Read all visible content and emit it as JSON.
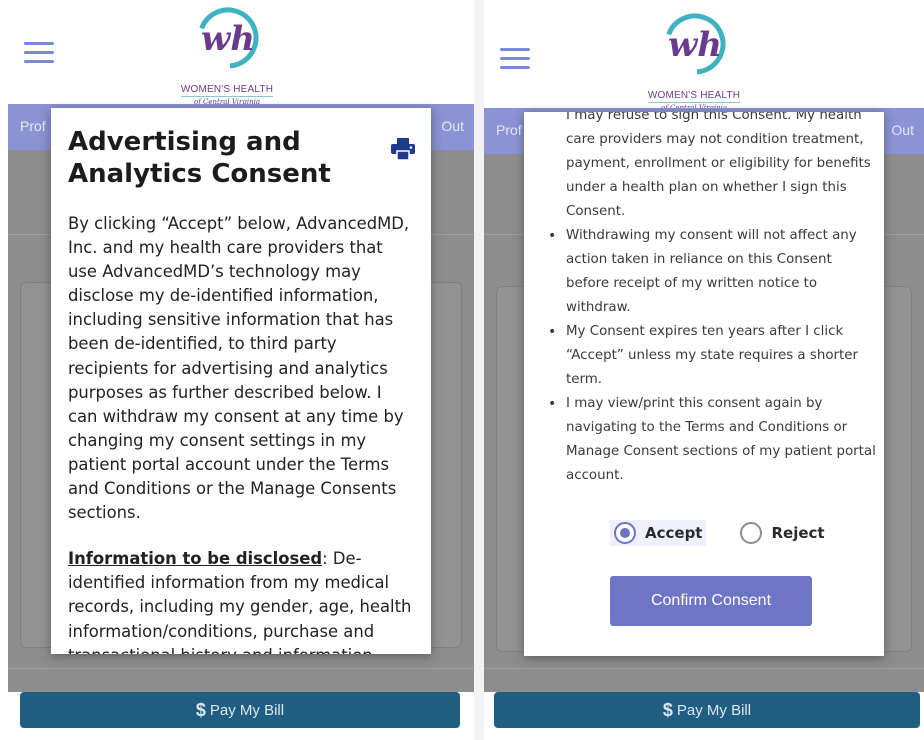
{
  "brand": {
    "logo_letters": "wh",
    "name": "WOMEN'S HEALTH",
    "tagline": "of Central Virginia"
  },
  "colors": {
    "nav_bg": "#8a93d3",
    "hamburger": "#7b8ad8",
    "pay_bar": "#1f5e80",
    "confirm_button": "#6e74c6",
    "logo_purple": "#6a3b8c",
    "logo_teal": "#3fb2c2"
  },
  "left": {
    "nav": {
      "left_text": "Prof",
      "right_text": "Out"
    },
    "modal": {
      "title": "Advertising and Analytics Consent",
      "print_icon": "printer-icon",
      "paragraph1": "By clicking “Accept” below, AdvancedMD, Inc. and my health care providers that use AdvancedMD’s technology may disclose my de-identified information, including sensitive information that has been de-identified, to third party recipients for advertising and analytics purposes as further described below. I can withdraw my consent at any time by changing my consent settings in my patient portal account under the Terms and Conditions or the Manage Consents sections.",
      "section_heading": "Information to be disclosed",
      "section_text": ": De-identified information from my medical records, including my gender, age, health information/conditions, purchase and transactional history and information about my interactions"
    },
    "pay_bill": "Pay My Bill"
  },
  "right": {
    "nav": {
      "left_text": "Prof",
      "right_text": "Out"
    },
    "modal": {
      "bullets": [
        {
          "text": "I may refuse to sign this Consent. My health care providers may not condition treatment, payment, enrollment or eligibility for benefits under a health plan on whether I sign this Consent.",
          "continued": true
        },
        {
          "text": "Withdrawing my consent will not affect any action taken in reliance on this Consent before receipt of my written notice to withdraw.",
          "continued": false
        },
        {
          "text": "My Consent expires ten years after I click “Accept” unless my state requires a shorter term.",
          "continued": false
        },
        {
          "text": "I may view/print this consent again by navigating to the Terms and Conditions or Manage Consent sections of my patient portal account.",
          "continued": false
        }
      ],
      "radio": {
        "selected": "accept",
        "accept_label": "Accept",
        "reject_label": "Reject"
      },
      "confirm_label": "Confirm Consent"
    },
    "pay_bill": "Pay My Bill"
  }
}
